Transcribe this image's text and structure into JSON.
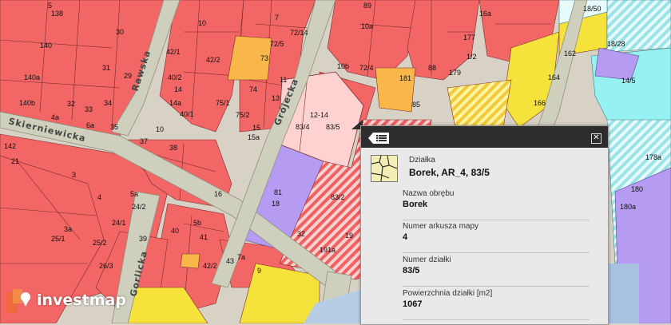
{
  "map": {
    "streets": [
      "Skierniewicka",
      "Rawska",
      "Grójecka",
      "Gorlicka"
    ],
    "parcel_labels": [
      "138",
      "30",
      "10",
      "89",
      "16a",
      "18/50",
      "140",
      "140a",
      "140b",
      "31",
      "29",
      "42/1",
      "42/2",
      "73",
      "74",
      "75/1",
      "75/2",
      "13",
      "14",
      "14a",
      "40/1",
      "40/2",
      "10",
      "37",
      "38",
      "33",
      "32",
      "34",
      "35",
      "6a",
      "4a",
      "142",
      "21",
      "3",
      "4",
      "5a",
      "24/1",
      "24/2",
      "39",
      "40",
      "3a",
      "25/1",
      "25/2",
      "26/3",
      "15",
      "15a",
      "16",
      "12-14",
      "83/4",
      "83/5",
      "81",
      "18",
      "83/2",
      "32",
      "19",
      "191a",
      "5b",
      "41",
      "42/2",
      "43",
      "7a",
      "9",
      "11",
      "7",
      "10a",
      "10b",
      "72/4",
      "72/5",
      "72/14",
      "181",
      "85",
      "88",
      "179",
      "177",
      "164",
      "166",
      "162",
      "18/28",
      "14/5",
      "178a",
      "180",
      "180a",
      "1/2",
      "5"
    ],
    "watermark_text": "investmap"
  },
  "popup": {
    "layer_name": "Działka",
    "title": "Borek, AR_4, 83/5",
    "fields": [
      {
        "label": "Nazwa obrębu",
        "value": "Borek"
      },
      {
        "label": "Numer arkusza mapy",
        "value": "4"
      },
      {
        "label": "Numer działki",
        "value": "83/5"
      },
      {
        "label": "Powierzchnia działki [m2]",
        "value": "1067"
      }
    ],
    "close_glyph": "✕",
    "icons": {
      "list": "list-icon",
      "close": "close-icon",
      "parcel": "parcel-map-icon"
    }
  },
  "colors": {
    "residential": "#f26666",
    "service": "#f9b74a",
    "selected": "#ffd2d2",
    "purple": "#b59cf2",
    "yellow": "#f5e23a",
    "cyan": "#96f2f2",
    "road": "#cfcfbd",
    "popup_bar": "#2d2d2d"
  }
}
